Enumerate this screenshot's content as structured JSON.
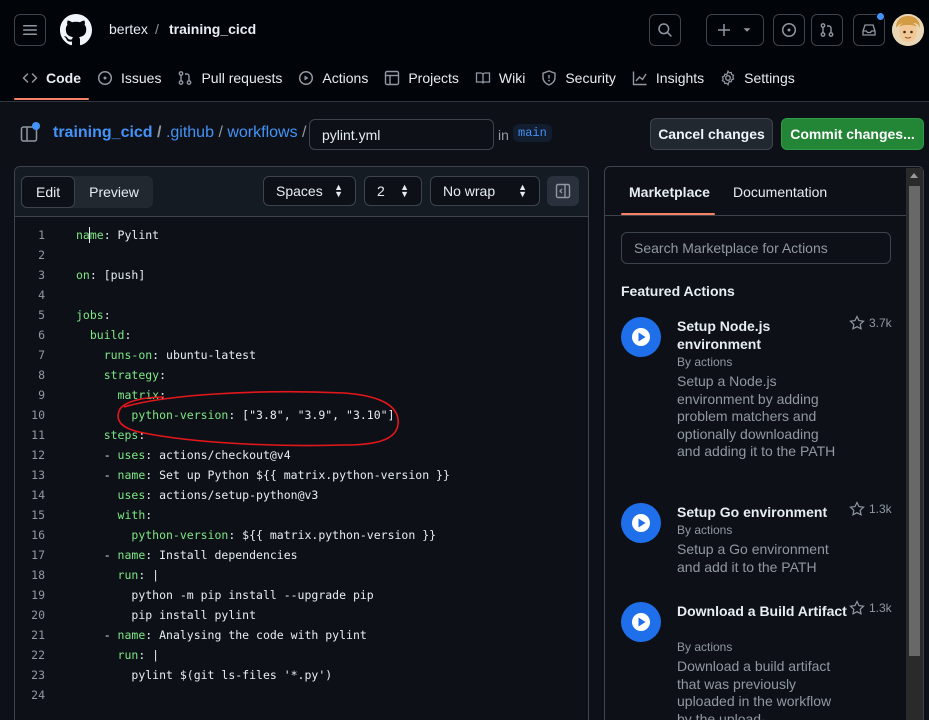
{
  "header": {
    "owner": "bertex",
    "separator": "/",
    "repo": "training_cicd"
  },
  "nav": [
    {
      "label": "Code",
      "icon": "code-icon",
      "active": true
    },
    {
      "label": "Issues",
      "icon": "issue-icon"
    },
    {
      "label": "Pull requests",
      "icon": "pull-request-icon"
    },
    {
      "label": "Actions",
      "icon": "play-icon"
    },
    {
      "label": "Projects",
      "icon": "table-icon"
    },
    {
      "label": "Wiki",
      "icon": "book-icon"
    },
    {
      "label": "Security",
      "icon": "shield-icon"
    },
    {
      "label": "Insights",
      "icon": "graph-icon"
    },
    {
      "label": "Settings",
      "icon": "gear-icon"
    }
  ],
  "path": {
    "repo": "training_cicd",
    "dir1": ".github",
    "dir2": "workflows",
    "sep": "/",
    "filename": "pylint.yml",
    "in": "in",
    "branch": "main"
  },
  "buttons": {
    "cancel": "Cancel changes",
    "commit": "Commit changes..."
  },
  "editor": {
    "tabs": [
      "Edit",
      "Preview"
    ],
    "indent_mode": "Spaces",
    "indent_size": "2",
    "wrap_mode": "No wrap",
    "lines": [
      {
        "n": "1",
        "key": "name",
        "rest": ": Pylint",
        "indent": ""
      },
      {
        "n": "2",
        "key": "",
        "rest": "",
        "indent": ""
      },
      {
        "n": "3",
        "key": "on",
        "rest": ": [push]",
        "indent": ""
      },
      {
        "n": "4",
        "key": "",
        "rest": "",
        "indent": ""
      },
      {
        "n": "5",
        "key": "jobs",
        "rest": ":",
        "indent": ""
      },
      {
        "n": "6",
        "key": "build",
        "rest": ":",
        "indent": "  "
      },
      {
        "n": "7",
        "key": "runs-on",
        "rest": ": ubuntu-latest",
        "indent": "    "
      },
      {
        "n": "8",
        "key": "strategy",
        "rest": ":",
        "indent": "    "
      },
      {
        "n": "9",
        "key": "matrix",
        "rest": ":",
        "indent": "      "
      },
      {
        "n": "10",
        "key": "python-version",
        "rest": ": [\"3.8\", \"3.9\", \"3.10\"]",
        "indent": "        "
      },
      {
        "n": "11",
        "key": "steps",
        "rest": ":",
        "indent": "    "
      },
      {
        "n": "12",
        "key": "uses",
        "rest": ": actions/checkout@v4",
        "indent": "    - "
      },
      {
        "n": "13",
        "key": "name",
        "rest": ": Set up Python ${{ matrix.python-version }}",
        "indent": "    - "
      },
      {
        "n": "14",
        "key": "uses",
        "rest": ": actions/setup-python@v3",
        "indent": "      "
      },
      {
        "n": "15",
        "key": "with",
        "rest": ":",
        "indent": "      "
      },
      {
        "n": "16",
        "key": "python-version",
        "rest": ": ${{ matrix.python-version }}",
        "indent": "        "
      },
      {
        "n": "17",
        "key": "name",
        "rest": ": Install dependencies",
        "indent": "    - "
      },
      {
        "n": "18",
        "key": "run",
        "rest": ": |",
        "indent": "      "
      },
      {
        "n": "19",
        "key": "",
        "rest": "python -m pip install --upgrade pip",
        "indent": "        "
      },
      {
        "n": "20",
        "key": "",
        "rest": "pip install pylint",
        "indent": "        "
      },
      {
        "n": "21",
        "key": "name",
        "rest": ": Analysing the code with pylint",
        "indent": "    - "
      },
      {
        "n": "22",
        "key": "run",
        "rest": ": |",
        "indent": "      "
      },
      {
        "n": "23",
        "key": "",
        "rest": "pylint $(git ls-files '*.py')",
        "indent": "        "
      },
      {
        "n": "24",
        "key": "",
        "rest": "",
        "indent": ""
      }
    ]
  },
  "sidebar": {
    "tabs": [
      "Marketplace",
      "Documentation"
    ],
    "search_placeholder": "Search Marketplace for Actions",
    "featured_heading": "Featured Actions",
    "actions": [
      {
        "title": "Setup Node.js environment",
        "by": "By actions",
        "desc": "Setup a Node.js environment by adding problem matchers and optionally downloading and adding it to the PATH",
        "stars": "3.7k"
      },
      {
        "title": "Setup Go environment",
        "by": "By actions",
        "desc": "Setup a Go environment and add it to the PATH",
        "stars": "1.3k"
      },
      {
        "title": "Download a Build Artifact",
        "by": "By actions",
        "desc": "Download a build artifact that was previously uploaded in the workflow by the upload-",
        "stars": "1.3k"
      }
    ]
  },
  "colors": {
    "accent": "#4493f8",
    "commit_green": "#238636",
    "nav_underline": "#f78166",
    "yaml_key": "#7ee787",
    "annotation": "#e5161b"
  }
}
